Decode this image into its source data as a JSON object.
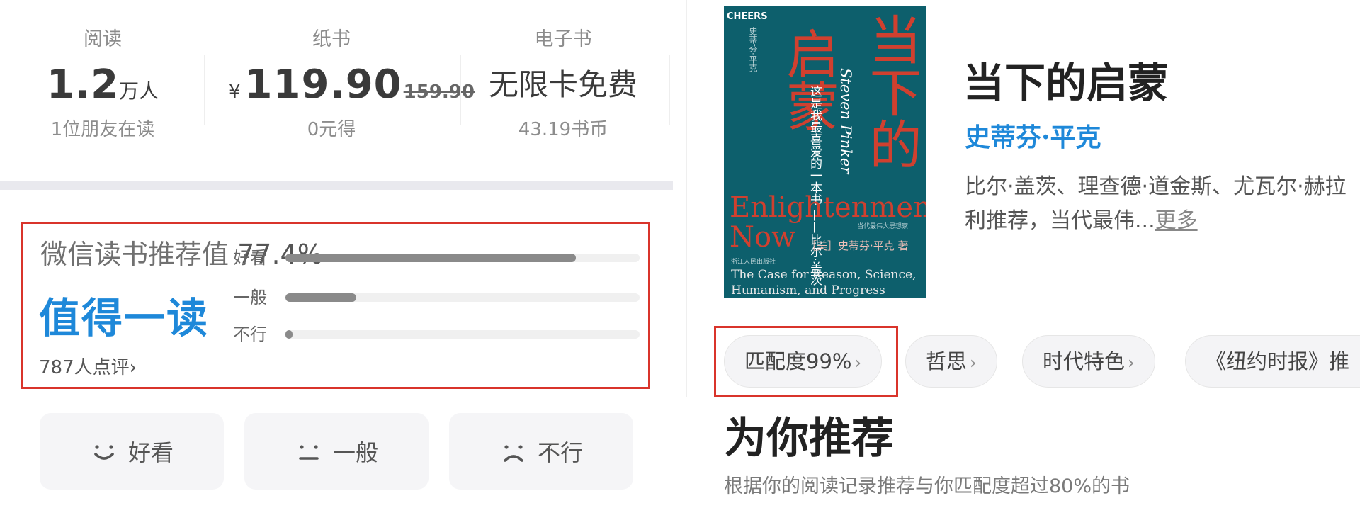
{
  "stats": {
    "reading": {
      "label": "阅读",
      "value": "1.2",
      "unit": "万人",
      "sub": "1位朋友在读"
    },
    "paper": {
      "label": "纸书",
      "currency": "¥",
      "price": "119.90",
      "original_price": "159.90",
      "sub": "0元得"
    },
    "ebook": {
      "label": "电子书",
      "value": "无限卡免费",
      "sub": "43.19书币"
    }
  },
  "rating": {
    "title": "微信读书推荐值",
    "score": "77.4",
    "percent_sign": "%",
    "verdict": "值得一读",
    "reviews_link": "787人点评",
    "reviews_chevron": "›",
    "bars": [
      {
        "label": "好看",
        "fraction": 0.82
      },
      {
        "label": "一般",
        "fraction": 0.2
      },
      {
        "label": "不行",
        "fraction": 0.015
      }
    ]
  },
  "reactions": [
    {
      "label": "好看",
      "icon": "smile-icon"
    },
    {
      "label": "一般",
      "icon": "neutral-face-icon"
    },
    {
      "label": "不行",
      "icon": "sad-face-icon"
    }
  ],
  "cover": {
    "brand": "CHEERS",
    "small_vertical": "史蒂芬·平克",
    "cn_left": "启蒙",
    "cn_right": "当下的",
    "blurb": "这是我最喜爱的一本书 ——比尔·盖茨",
    "author_en": "Steven Pinker",
    "en_title_1": "Enlightenment",
    "en_title_2": "Now",
    "series": "当代最伟大思想家",
    "author_cn": "［美］史蒂芬·平克 著",
    "publisher": "浙江人民出版社",
    "subtitle_1": "The Case for Reason, Science,",
    "subtitle_2": "Humanism, and Progress"
  },
  "book": {
    "title": "当下的启蒙",
    "author": "史蒂芬·平克",
    "description": "比尔·盖茨、理查德·道金斯、尤瓦尔·赫拉利推荐，当代最伟...",
    "more_label": "更多"
  },
  "tags": [
    {
      "label": "匹配度99%",
      "chevron": "›"
    },
    {
      "label": "哲思",
      "chevron": "›"
    },
    {
      "label": "时代特色",
      "chevron": "›"
    },
    {
      "label": "《纽约时报》推",
      "chevron": ""
    }
  ],
  "recommend": {
    "title": "为你推荐",
    "subtitle": "根据你的阅读记录推荐与你匹配度超过80%的书"
  },
  "colors": {
    "accent_blue": "#1e88d9",
    "highlight_red": "#d9342b",
    "cover_teal": "#0d5f6c",
    "cover_red": "#d0402f"
  }
}
